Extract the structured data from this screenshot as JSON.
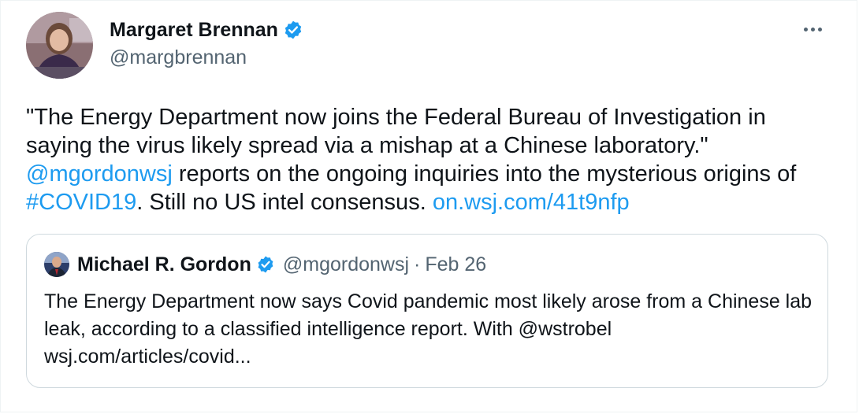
{
  "author": {
    "name": "Margaret Brennan",
    "handle": "@margbrennan",
    "avatar_icon": "profile-photo",
    "verified_icon": "verified-badge-icon"
  },
  "tweet": {
    "text_1": "\"The Energy Department now joins the Federal Bureau of Investigation in saying the virus likely spread via a mishap at a Chinese laboratory.\" ",
    "mention": "@mgordonwsj",
    "text_2": " reports on the ongoing inquiries into the mysterious origins of ",
    "hashtag": "#COVID19",
    "text_3": ". Still no US intel consensus. ",
    "url": "on.wsj.com/41t9nfp"
  },
  "quote": {
    "name": "Michael R. Gordon",
    "handle": "@mgordonwsj",
    "separator": "·",
    "date": "Feb 26",
    "text": "The Energy Department now says Covid pandemic most likely arose from a Chinese lab leak, according to a classified intelligence report. With @wstrobel wsj.com/articles/covid..."
  },
  "colors": {
    "link": "#1d9bf0",
    "text": "#0f1419",
    "secondary": "#536471",
    "border": "#cfd9de"
  },
  "icons": {
    "more": "more-options-icon",
    "verified": "verified-badge-icon"
  }
}
